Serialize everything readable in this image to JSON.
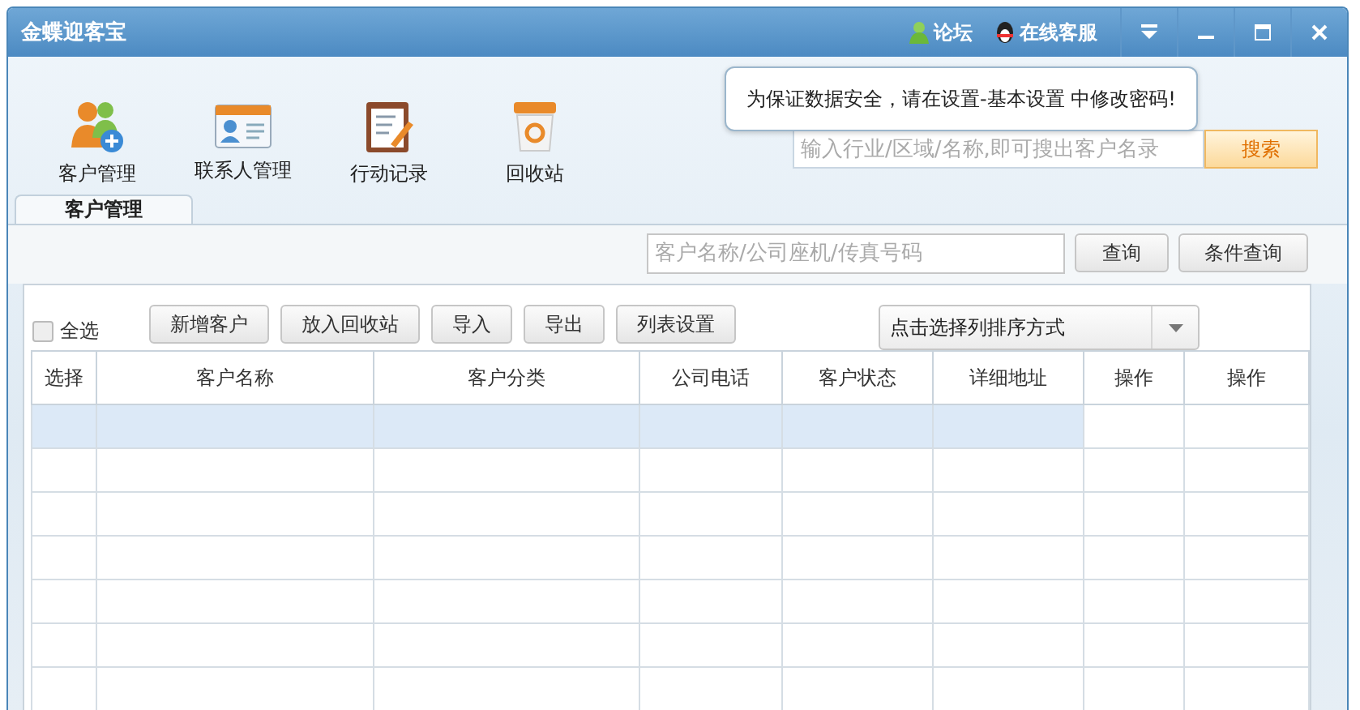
{
  "window": {
    "title": "金蝶迎客宝",
    "links": [
      {
        "kind": "forum",
        "label": "论坛"
      },
      {
        "kind": "service",
        "label": "在线客服"
      }
    ]
  },
  "notice": "为保证数据安全，请在设置-基本设置 中修改密码!",
  "toolbar": [
    {
      "kind": "customers",
      "label": "客户管理"
    },
    {
      "kind": "contacts",
      "label": "联系人管理"
    },
    {
      "kind": "records",
      "label": "行动记录"
    },
    {
      "kind": "recycle",
      "label": "回收站"
    }
  ],
  "global_search": {
    "placeholder": "输入行业/区域/名称,即可搜出客户名录",
    "button": "搜索"
  },
  "tabs": [
    {
      "label": "客户管理",
      "selected": true
    }
  ],
  "query": {
    "placeholder": "客户名称/公司座机/传真号码",
    "buttons": [
      "查询",
      "条件查询"
    ]
  },
  "select_all": {
    "label": "全选",
    "checked": false
  },
  "actions": [
    "新增客户",
    "放入回收站",
    "导入",
    "导出",
    "列表设置"
  ],
  "sort": {
    "placeholder": "点击选择列排序方式"
  },
  "table": {
    "columns": [
      "选择",
      "客户名称",
      "客户分类",
      "公司电话",
      "客户状态",
      "详细地址",
      "操作",
      "操作"
    ],
    "rows": [
      {
        "selected": true
      },
      {
        "selected": false
      },
      {
        "selected": false
      },
      {
        "selected": false
      },
      {
        "selected": false
      },
      {
        "selected": false
      },
      {
        "selected": false
      }
    ]
  }
}
